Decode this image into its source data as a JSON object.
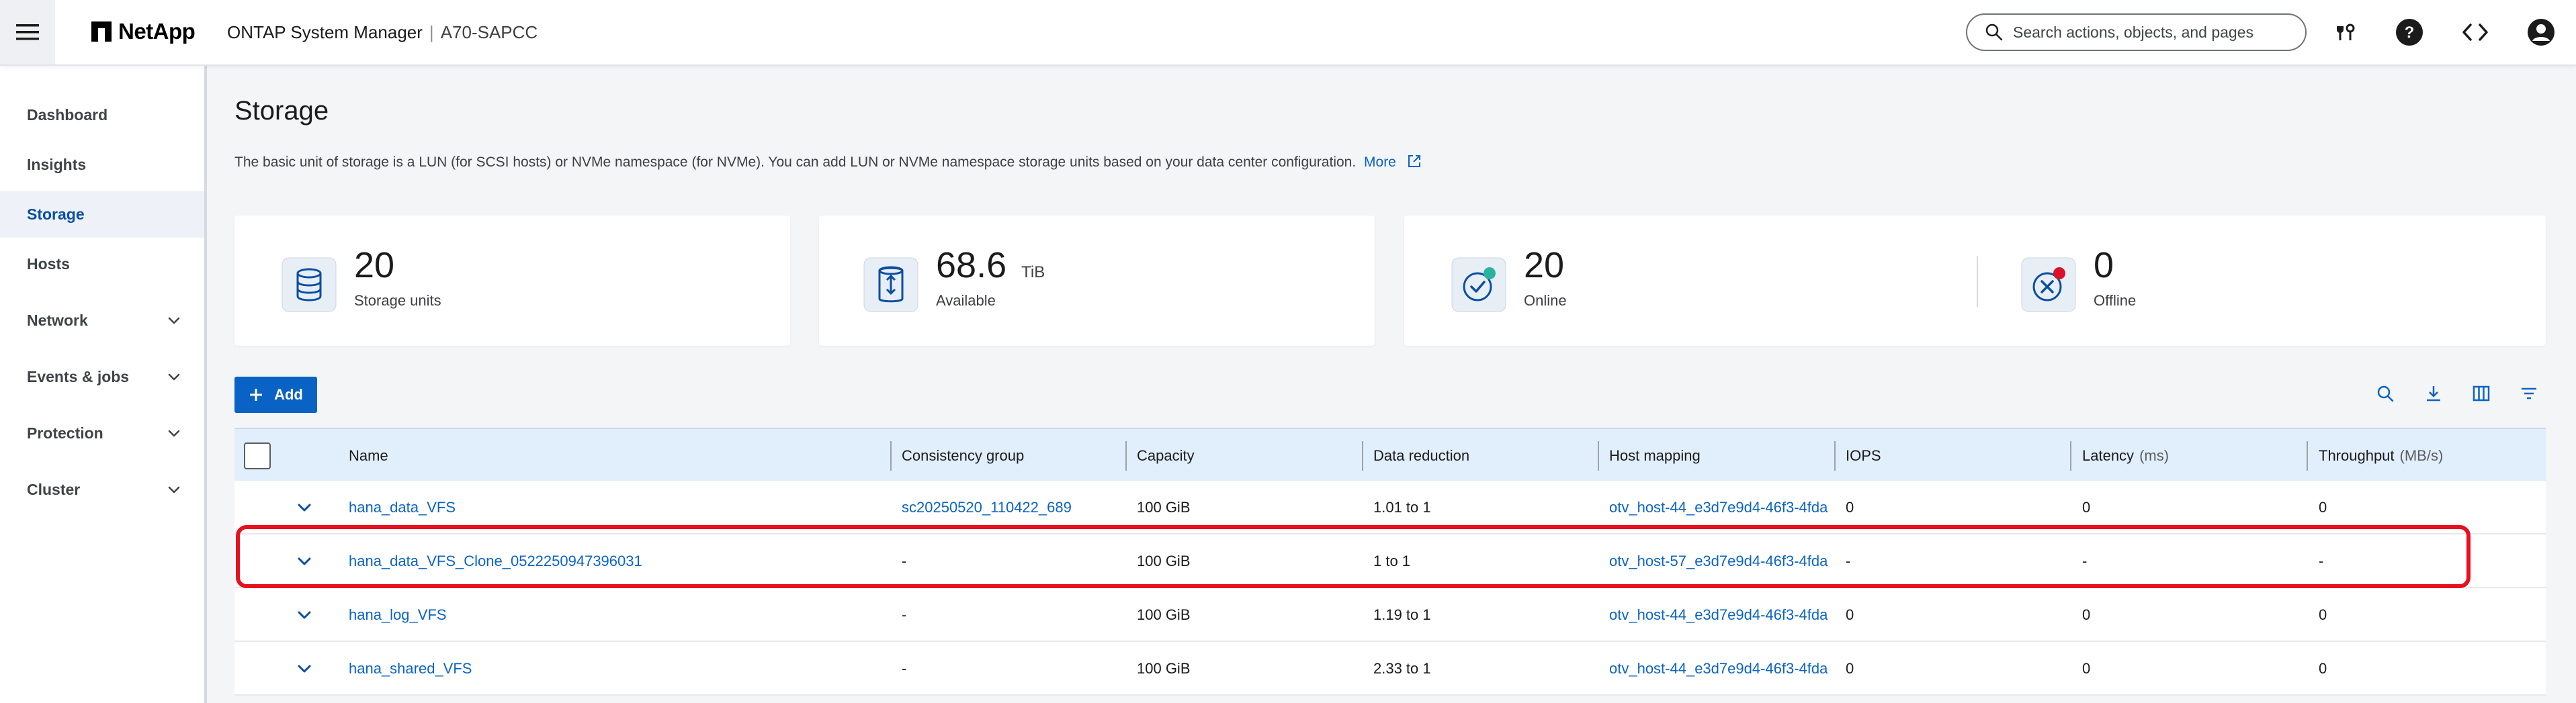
{
  "app": {
    "brand": "NetApp",
    "product": "ONTAP System Manager",
    "separator": "|",
    "cluster": "A70-SAPCC"
  },
  "search": {
    "placeholder": "Search actions, objects, and pages"
  },
  "header_icons": [
    "services-icon",
    "help-icon",
    "api-code-icon",
    "user-account-icon"
  ],
  "sidebar": {
    "items": [
      {
        "label": "Dashboard",
        "expandable": false,
        "active": false
      },
      {
        "label": "Insights",
        "expandable": false,
        "active": false
      },
      {
        "label": "Storage",
        "expandable": false,
        "active": true
      },
      {
        "label": "Hosts",
        "expandable": false,
        "active": false
      },
      {
        "label": "Network",
        "expandable": true,
        "active": false
      },
      {
        "label": "Events & jobs",
        "expandable": true,
        "active": false
      },
      {
        "label": "Protection",
        "expandable": true,
        "active": false
      },
      {
        "label": "Cluster",
        "expandable": true,
        "active": false
      }
    ]
  },
  "page": {
    "title": "Storage",
    "description": "The basic unit of storage is a LUN (for SCSI hosts) or NVMe namespace (for NVMe). You can add LUN or NVMe namespace storage units based on your data center configuration.",
    "more_link": "More"
  },
  "metrics": {
    "storage_units": {
      "value": "20",
      "label": "Storage units",
      "icon": "database-icon"
    },
    "available": {
      "value": "68.6",
      "unit": "TiB",
      "label": "Available",
      "icon": "capacity-icon"
    },
    "online": {
      "value": "20",
      "label": "Online",
      "icon": "online-check-icon"
    },
    "offline": {
      "value": "0",
      "label": "Offline",
      "icon": "offline-x-icon"
    }
  },
  "toolbar": {
    "add_label": "Add",
    "icons": [
      "search-icon",
      "download-icon",
      "columns-icon",
      "filter-icon"
    ]
  },
  "table": {
    "columns": [
      {
        "label": "Name",
        "unit": ""
      },
      {
        "label": "Consistency group",
        "unit": ""
      },
      {
        "label": "Capacity",
        "unit": ""
      },
      {
        "label": "Data reduction",
        "unit": ""
      },
      {
        "label": "Host mapping",
        "unit": ""
      },
      {
        "label": "IOPS",
        "unit": ""
      },
      {
        "label": "Latency",
        "unit": "(ms)"
      },
      {
        "label": "Throughput",
        "unit": "(MB/s)"
      }
    ],
    "rows": [
      {
        "name": "hana_data_VFS",
        "cg": "sc20250520_110422_689",
        "capacity": "100 GiB",
        "reduction": "1.01 to 1",
        "host": "otv_host-44_e3d7e9d4-46f3-4fda",
        "iops": "0",
        "latency": "0",
        "throughput": "0"
      },
      {
        "name": "hana_data_VFS_Clone_0522250947396031",
        "cg": "-",
        "capacity": "100 GiB",
        "reduction": "1 to 1",
        "host": "otv_host-57_e3d7e9d4-46f3-4fda",
        "iops": "-",
        "latency": "-",
        "throughput": "-"
      },
      {
        "name": "hana_log_VFS",
        "cg": "-",
        "capacity": "100 GiB",
        "reduction": "1.19 to 1",
        "host": "otv_host-44_e3d7e9d4-46f3-4fda",
        "iops": "0",
        "latency": "0",
        "throughput": "0"
      },
      {
        "name": "hana_shared_VFS",
        "cg": "-",
        "capacity": "100 GiB",
        "reduction": "2.33 to 1",
        "host": "otv_host-44_e3d7e9d4-46f3-4fda",
        "iops": "0",
        "latency": "0",
        "throughput": "0"
      }
    ]
  },
  "colors": {
    "accent": "#0a63c4",
    "nav_active": "#0a4fa1",
    "table_header": "#e1eefb",
    "highlight": "#e8101f",
    "online_dot": "#2bb3a0",
    "offline_dot": "#d9122a"
  }
}
